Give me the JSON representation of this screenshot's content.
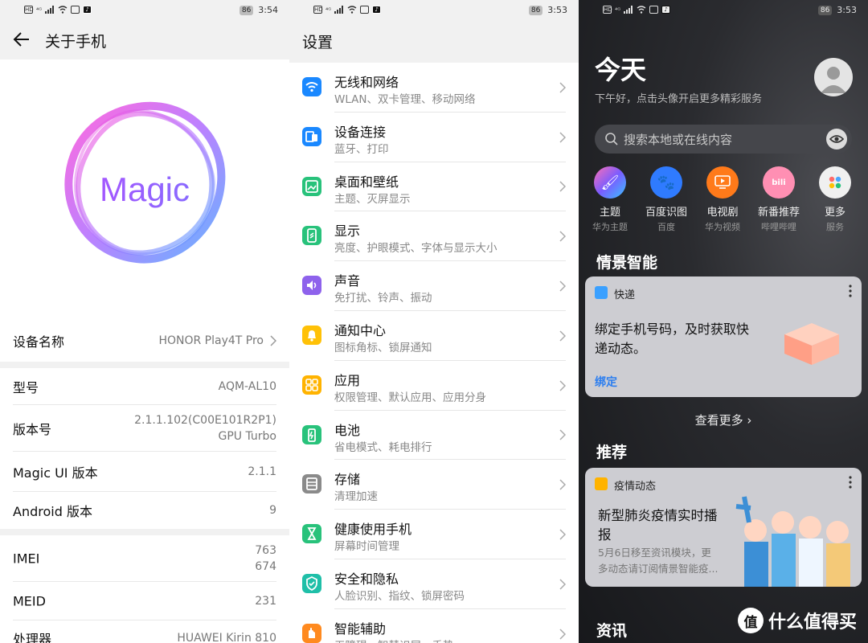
{
  "status": {
    "left_icons": [
      "HD",
      "4G",
      "signal",
      "wifi",
      "mail",
      "tiktok"
    ],
    "battery": "86",
    "time_p1": "3:54",
    "time_p2": "3:53",
    "time_p3": "3:53"
  },
  "about": {
    "title": "关于手机",
    "hero_word": "Magic",
    "rows_group1": [
      {
        "label": "设备名称",
        "value": "HONOR Play4T Pro"
      }
    ],
    "rows_group2": [
      {
        "label": "型号",
        "value": "AQM-AL10"
      },
      {
        "label": "版本号",
        "value_line1": "2.1.1.102(C00E101R2P1)",
        "value_line2": "GPU Turbo"
      },
      {
        "label": "Magic UI 版本",
        "value": "2.1.1"
      },
      {
        "label": "Android 版本",
        "value": "9"
      }
    ],
    "rows_group3": [
      {
        "label": "IMEI",
        "value_line1": "763",
        "value_line2": "674"
      },
      {
        "label": "MEID",
        "value": "231"
      },
      {
        "label": "处理器",
        "value": "HUAWEI Kirin 810"
      }
    ]
  },
  "settings": {
    "title": "设置",
    "items": [
      {
        "title": "无线和网络",
        "sub": "WLAN、双卡管理、移动网络",
        "icon": "wifi-icon",
        "color": "#1a88ff"
      },
      {
        "title": "设备连接",
        "sub": "蓝牙、打印",
        "icon": "device-connect-icon",
        "color": "#1a88ff"
      },
      {
        "title": "桌面和壁纸",
        "sub": "主题、灭屏显示",
        "icon": "wallpaper-icon",
        "color": "#28c27b"
      },
      {
        "title": "显示",
        "sub": "亮度、护眼模式、字体与显示大小",
        "icon": "display-icon",
        "color": "#28c27b"
      },
      {
        "title": "声音",
        "sub": "免打扰、铃声、振动",
        "icon": "sound-icon",
        "color": "#8e62ec"
      },
      {
        "title": "通知中心",
        "sub": "图标角标、锁屏通知",
        "icon": "bell-icon",
        "color": "#ffc107"
      },
      {
        "title": "应用",
        "sub": "权限管理、默认应用、应用分身",
        "icon": "apps-icon",
        "color": "#ffb300"
      },
      {
        "title": "电池",
        "sub": "省电模式、耗电排行",
        "icon": "battery-icon",
        "color": "#28c27b"
      },
      {
        "title": "存储",
        "sub": "清理加速",
        "icon": "storage-icon",
        "color": "#8a8a8a"
      },
      {
        "title": "健康使用手机",
        "sub": "屏幕时间管理",
        "icon": "hourglass-icon",
        "color": "#28c27b"
      },
      {
        "title": "安全和隐私",
        "sub": "人脸识别、指纹、锁屏密码",
        "icon": "shield-icon",
        "color": "#1fbfa8"
      },
      {
        "title": "智能辅助",
        "sub": "无障碍、智慧识屏、手势",
        "icon": "hand-icon",
        "color": "#ff8a1f"
      }
    ]
  },
  "today": {
    "title": "今天",
    "subtitle": "下午好，点击头像开启更多精彩服务",
    "search_placeholder": "搜索本地或在线内容",
    "apps": [
      {
        "name": "主题",
        "source": "华为主题",
        "icon": "theme-brush-icon",
        "color": "#7a5cff"
      },
      {
        "name": "百度识图",
        "source": "百度",
        "icon": "baidu-paw-icon",
        "color": "#2f7bff"
      },
      {
        "name": "电视剧",
        "source": "华为视频",
        "icon": "tv-play-icon",
        "color": "#ff7a1a"
      },
      {
        "name": "新番推荐",
        "source": "哔哩哔哩",
        "icon": "bilibili-icon",
        "color": "#ff8fb3"
      },
      {
        "name": "更多",
        "source": "服务",
        "icon": "more-apps-icon",
        "color": "#f0f0f0"
      }
    ],
    "section_smart": "情景智能",
    "express_card": {
      "header": "快递",
      "body_line1": "绑定手机号码，及时获取快",
      "body_line2": "递动态。",
      "action": "绑定"
    },
    "view_more": "查看更多",
    "section_recommend": "推荐",
    "news_card": {
      "header": "疫情动态",
      "title_line1": "新型肺炎疫情实时播",
      "title_line2": "报",
      "desc_line1": "5月6日移至资讯模块，更",
      "desc_line2": "多动态请订阅情景智能疫..."
    },
    "section_news": "资讯",
    "watermark_badge": "值",
    "watermark_text": "什么值得买"
  }
}
